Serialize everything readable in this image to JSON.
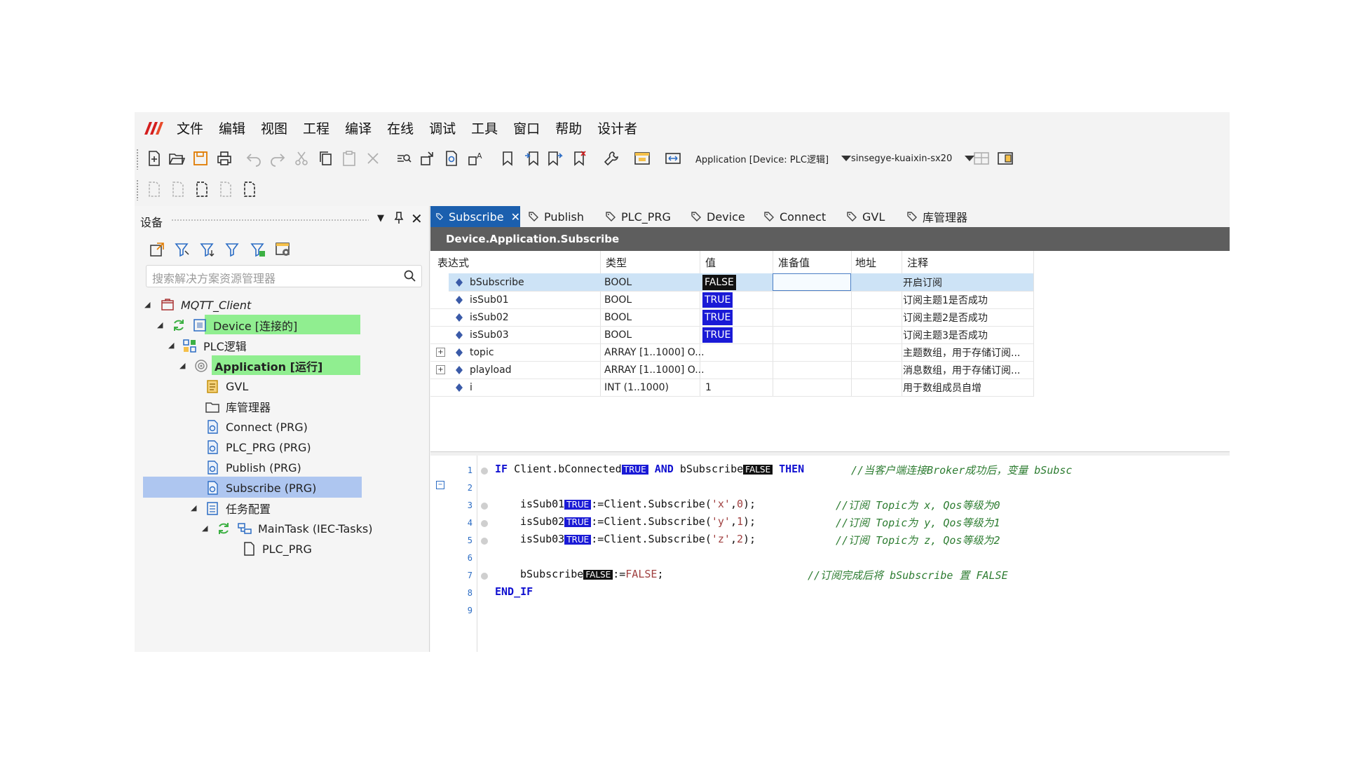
{
  "menu": [
    "文件",
    "编辑",
    "视图",
    "工程",
    "编译",
    "在线",
    "调试",
    "工具",
    "窗口",
    "帮助",
    "设计者"
  ],
  "toolbar": {
    "app_combo": "Application [Device: PLC逻辑]",
    "device_combo": "sinsegye-kuaixin-sx20"
  },
  "devices": {
    "title": "设备",
    "search_placeholder": "搜索解决方案资源管理器",
    "tree": {
      "root": "MQTT_Client",
      "device": "Device [连接的]",
      "plc": "PLC逻辑",
      "application": "Application [运行]",
      "gvl": "GVL",
      "libmgr": "库管理器",
      "connect": "Connect (PRG)",
      "plc_prg": "PLC_PRG (PRG)",
      "publish": "Publish (PRG)",
      "subscribe": "Subscribe (PRG)",
      "taskcfg": "任务配置",
      "maintask": "MainTask (IEC-Tasks)",
      "plc_prg_call": "PLC_PRG"
    }
  },
  "tabs": [
    "Subscribe",
    "Publish",
    "PLC_PRG",
    "Device",
    "Connect",
    "GVL",
    "库管理器"
  ],
  "path": "Device.Application.Subscribe",
  "watch": {
    "headers": [
      "表达式",
      "类型",
      "值",
      "准备值",
      "地址",
      "注释"
    ],
    "rows": [
      {
        "expr": "bSubscribe",
        "type": "BOOL",
        "value": "FALSE",
        "comment": "开启订阅"
      },
      {
        "expr": "isSub01",
        "type": "BOOL",
        "value": "TRUE",
        "comment": "订阅主题1是否成功"
      },
      {
        "expr": "isSub02",
        "type": "BOOL",
        "value": "TRUE",
        "comment": "订阅主题2是否成功"
      },
      {
        "expr": "isSub03",
        "type": "BOOL",
        "value": "TRUE",
        "comment": "订阅主题3是否成功"
      },
      {
        "expr": "topic",
        "type": "ARRAY [1..1000] O...",
        "value": "",
        "comment": "主题数组，用于存储订阅..."
      },
      {
        "expr": "playload",
        "type": "ARRAY [1..1000] O...",
        "value": "",
        "comment": "消息数组，用于存储订阅..."
      },
      {
        "expr": "i",
        "type": "INT (1..1000)",
        "value": "1",
        "comment": "用于数组成员自增"
      }
    ]
  },
  "code": {
    "line_numbers": [
      "1",
      "2",
      "3",
      "4",
      "5",
      "6",
      "7",
      "8",
      "9"
    ],
    "l1": {
      "kw_if": "IF",
      "a": " Client.bConnected",
      "iv1": "TRUE",
      "kw_and": " AND",
      "b": " bSubscribe",
      "iv2": "FALSE",
      "kw_then": " THEN",
      "comment": "//当客户端连接Broker成功后，变量 bSubsc"
    },
    "l3": {
      "a": "isSub01",
      "iv": "TRUE",
      "b": ":=Client.Subscribe(",
      "s": "'x'",
      "c": ",",
      "n": "0",
      "d": ");",
      "comment": "//订阅 Topic为 x, Qos等级为0"
    },
    "l4": {
      "a": "isSub02",
      "iv": "TRUE",
      "b": ":=Client.Subscribe(",
      "s": "'y'",
      "c": ",",
      "n": "1",
      "d": ");",
      "comment": "//订阅 Topic为 y, Qos等级为1"
    },
    "l5": {
      "a": "isSub03",
      "iv": "TRUE",
      "b": ":=Client.Subscribe(",
      "s": "'z'",
      "c": ",",
      "n": "2",
      "d": ");",
      "comment": "//订阅 Topic为 z, Qos等级为2"
    },
    "l7": {
      "a": "bSubscribe",
      "iv": "FALSE",
      "b": ":=",
      "v": "FALSE",
      "d": ";",
      "comment": "//订阅完成后将 bSubscribe 置 FALSE"
    },
    "l8": {
      "kw": "END_IF"
    }
  }
}
